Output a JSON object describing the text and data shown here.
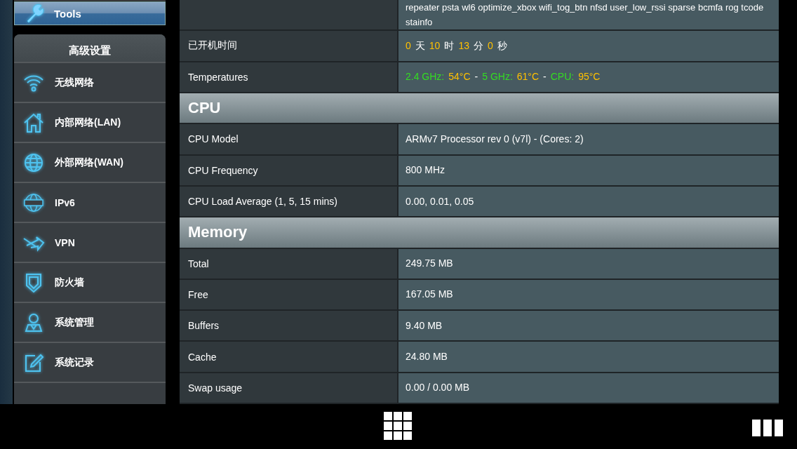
{
  "sidebar": {
    "tools": {
      "label": "Tools",
      "selected": true
    },
    "section_title": "高级设置",
    "items": [
      {
        "label": "无线网络",
        "selected": false
      },
      {
        "label": "内部网络(LAN)",
        "selected": false
      },
      {
        "label": "外部网络(WAN)",
        "selected": false
      },
      {
        "label": "IPv6",
        "selected": false
      },
      {
        "label": "VPN",
        "selected": false
      },
      {
        "label": "防火墙",
        "selected": false
      },
      {
        "label": "系统管理",
        "selected": false
      },
      {
        "label": "系统记录",
        "selected": false
      }
    ]
  },
  "table": [
    {
      "kind": "row",
      "value_lines": [
        "repeater psta wl6 optimize_xbox wifi_tog_btn nfsd user_low_rssi sparse bcmfa rog tcode",
        "stainfo"
      ]
    },
    {
      "kind": "row",
      "label": "已开机时间",
      "parts": [
        {
          "text": "0",
          "kind": "number"
        },
        {
          "text": "天",
          "kind": "unit"
        },
        {
          "text": "10",
          "kind": "number"
        },
        {
          "text": "时",
          "kind": "unit"
        },
        {
          "text": "13",
          "kind": "number"
        },
        {
          "text": "分",
          "kind": "unit"
        },
        {
          "text": "0",
          "kind": "number"
        },
        {
          "text": "秒",
          "kind": "unit"
        }
      ]
    },
    {
      "kind": "row",
      "label": "Temperatures",
      "parts": [
        {
          "text": "2.4 GHz:",
          "kind": "name"
        },
        {
          "text": "54°C",
          "kind": "number"
        },
        {
          "text": "-",
          "kind": "unit"
        },
        {
          "text": "5 GHz:",
          "kind": "name"
        },
        {
          "text": "61°C",
          "kind": "number"
        },
        {
          "text": "-",
          "kind": "unit"
        },
        {
          "text": "CPU:",
          "kind": "name"
        },
        {
          "text": "95°C",
          "kind": "number"
        }
      ]
    },
    {
      "kind": "header",
      "label": "CPU"
    },
    {
      "kind": "row",
      "label": "CPU Model",
      "value_lines": [
        "ARMv7 Processor rev 0 (v7l)  -  (Cores: 2)"
      ]
    },
    {
      "kind": "row",
      "label": "CPU Frequency",
      "value_lines": [
        "800 MHz"
      ]
    },
    {
      "kind": "row",
      "label": "CPU Load Average (1, 5, 15 mins)",
      "value_lines": [
        "0.00,  0.01,  0.05"
      ]
    },
    {
      "kind": "header",
      "label": "Memory"
    },
    {
      "kind": "row",
      "label": "Total",
      "value_lines": [
        "249.75 MB"
      ]
    },
    {
      "kind": "row",
      "label": "Free",
      "value_lines": [
        "167.05 MB"
      ]
    },
    {
      "kind": "row",
      "label": "Buffers",
      "value_lines": [
        "9.40 MB"
      ]
    },
    {
      "kind": "row",
      "label": "Cache",
      "value_lines": [
        "24.80 MB"
      ]
    },
    {
      "kind": "row",
      "label": "Swap usage",
      "value_lines": [
        "0.00 / 0.00 MB"
      ]
    }
  ]
}
